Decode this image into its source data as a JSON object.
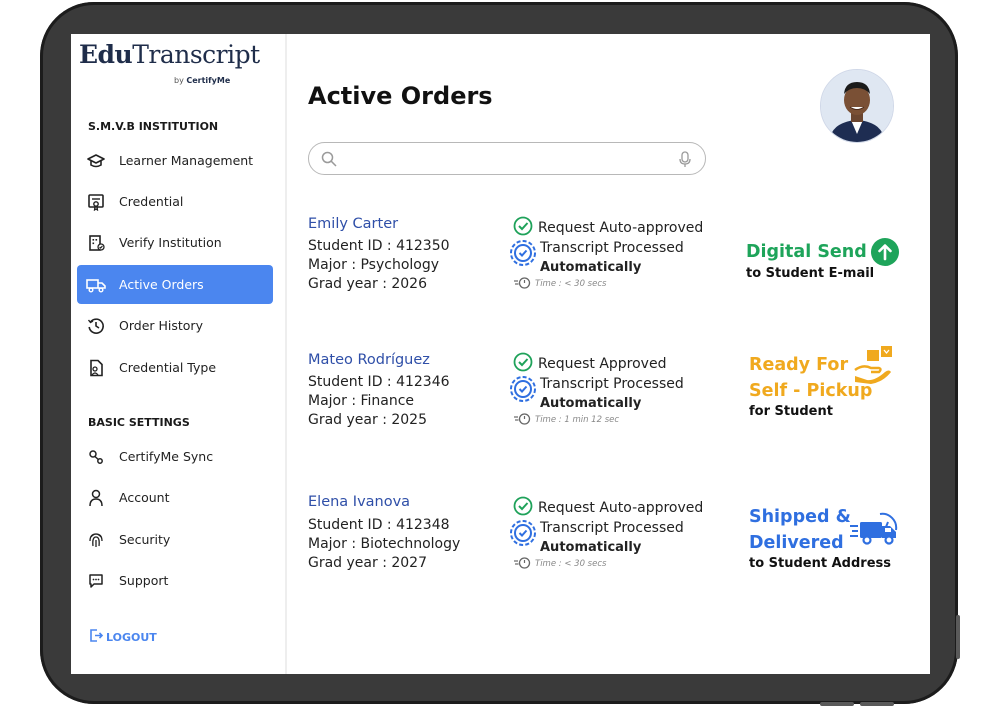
{
  "app": {
    "logo_edu": "Edu",
    "logo_transcript": "Transcript",
    "logo_by": "by",
    "logo_brand": "CertifyMe"
  },
  "sidebar": {
    "institution": "S.M.V.B INSTITUTION",
    "items": [
      {
        "label": "Learner Management",
        "icon": "graduation-cap-icon"
      },
      {
        "label": "Credential",
        "icon": "certificate-icon"
      },
      {
        "label": "Verify Institution",
        "icon": "building-check-icon"
      },
      {
        "label": "Active Orders",
        "icon": "truck-icon",
        "active": true
      },
      {
        "label": "Order History",
        "icon": "history-icon"
      },
      {
        "label": "Credential Type",
        "icon": "document-user-icon"
      }
    ],
    "basic_settings": "BASIC SETTINGS",
    "settings": [
      {
        "label": "CertifyMe Sync",
        "icon": "sync-nodes-icon"
      },
      {
        "label": "Account",
        "icon": "user-icon"
      },
      {
        "label": "Security",
        "icon": "fingerprint-icon"
      },
      {
        "label": "Support",
        "icon": "chat-icon"
      }
    ],
    "logout": "LOGOUT"
  },
  "main": {
    "title": "Active Orders",
    "search": {
      "value": "",
      "placeholder": ""
    }
  },
  "orders": [
    {
      "name": "Emily Carter",
      "student_id": "Student ID : 412350",
      "major": "Major : Psychology",
      "grad_year": "Grad year : 2026",
      "status1": "Request Auto-approved",
      "status2": "Transcript Processed",
      "status2b": "Automatically",
      "time": "Time :  < 30 secs",
      "delivery_line1": "Digital Send",
      "delivery_line2": "",
      "delivery_sub": "to Student E-mail",
      "delivery_color": "#1ea45a",
      "delivery_icon": "upload-arrow-icon"
    },
    {
      "name": "Mateo Rodríguez",
      "student_id": "Student ID : 412346",
      "major": "Major : Finance",
      "grad_year": "Grad year : 2025",
      "status1": "Request Approved",
      "status2": "Transcript Processed",
      "status2b": "Automatically",
      "time": "Time :  1 min 12 sec",
      "delivery_line1": "Ready For",
      "delivery_line2": "Self - Pickup",
      "delivery_sub": "for Student",
      "delivery_color": "#f0a91e",
      "delivery_icon": "hand-package-icon"
    },
    {
      "name": "Elena Ivanova",
      "student_id": "Student ID : 412348",
      "major": "Major : Biotechnology",
      "grad_year": "Grad year : 2027",
      "status1": "Request Auto-approved",
      "status2": "Transcript Processed",
      "status2b": "Automatically",
      "time": "Time :  < 30 secs",
      "delivery_line1": "Shipped &",
      "delivery_line2": "Delivered",
      "delivery_sub": "to Student Address",
      "delivery_color": "#2f6fe0",
      "delivery_icon": "delivery-truck-icon"
    }
  ]
}
